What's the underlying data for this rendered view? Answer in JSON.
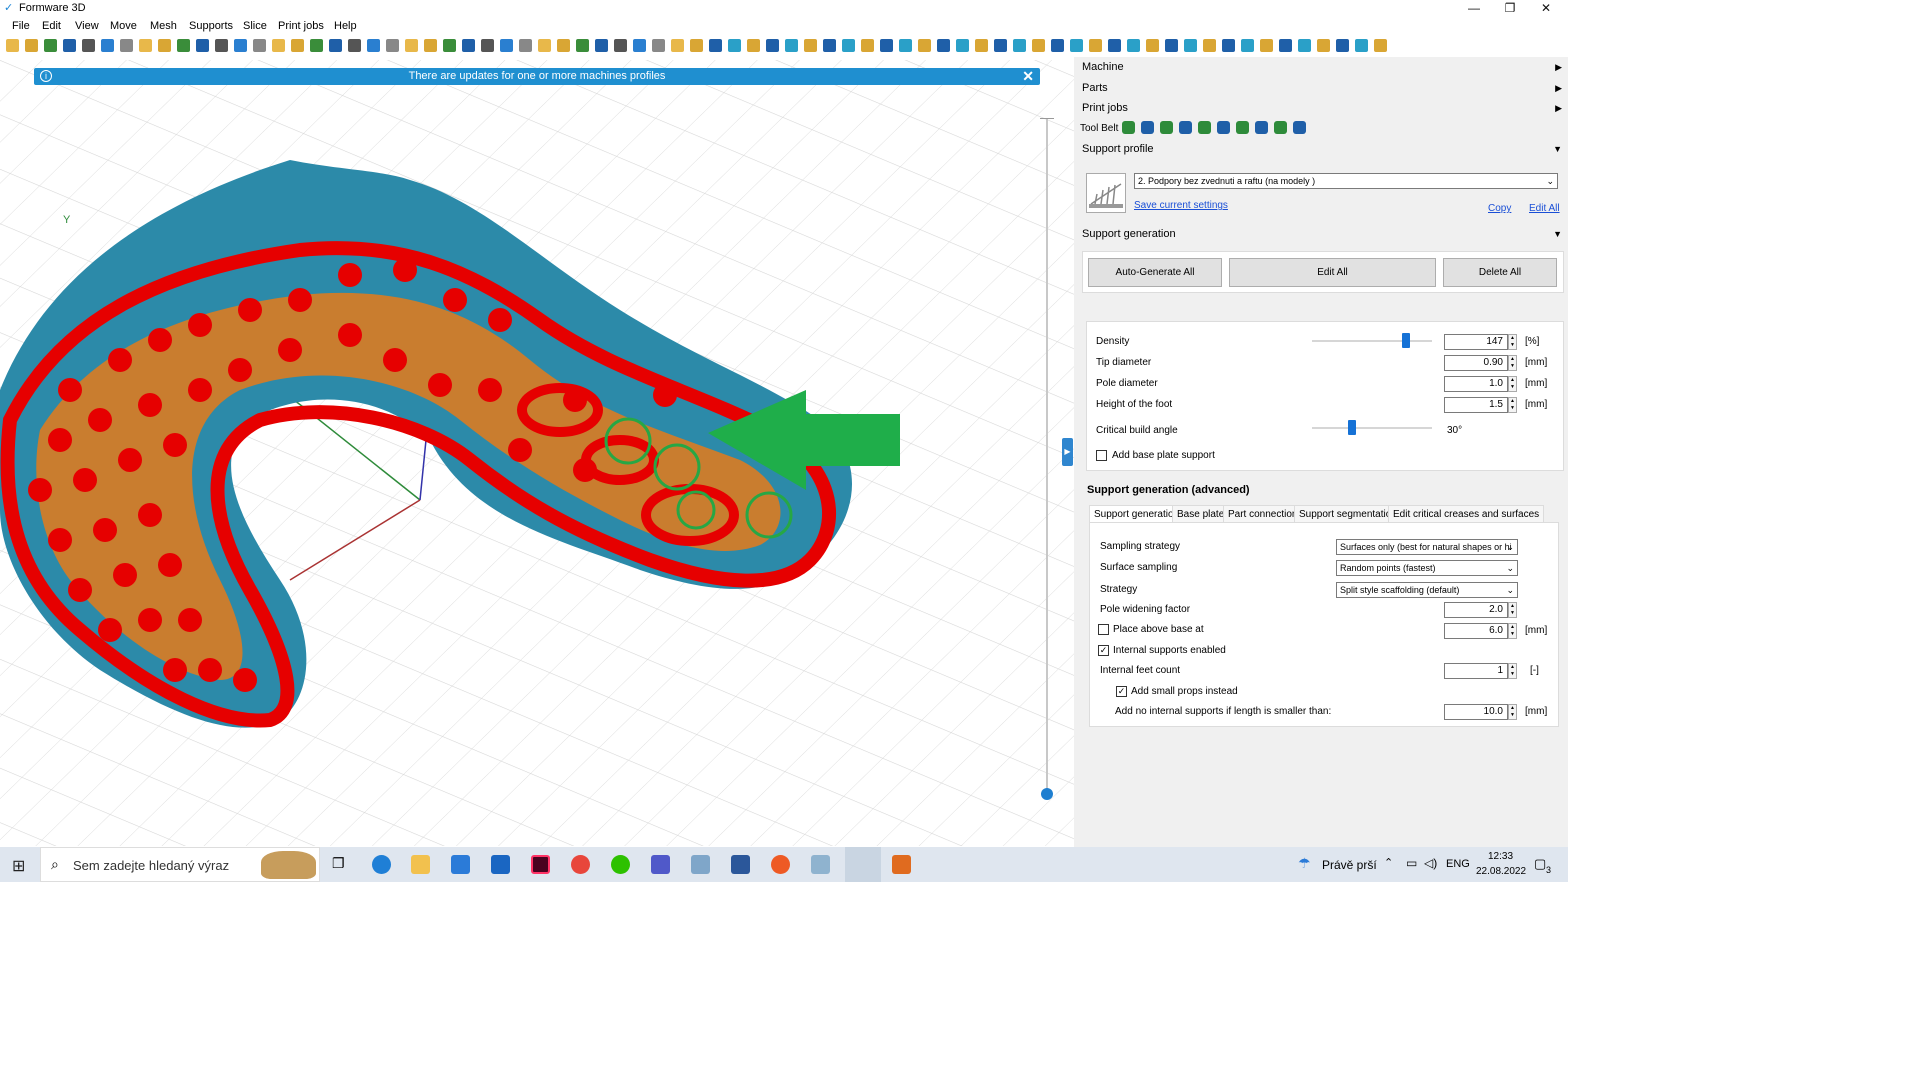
{
  "window": {
    "title": "Formware 3D",
    "min_icon": "minimize-icon",
    "max_icon": "maximize-icon",
    "close_icon": "close-icon"
  },
  "menu": [
    "File",
    "Edit",
    "View",
    "Move",
    "Mesh",
    "Supports",
    "Slice",
    "Print jobs",
    "Help"
  ],
  "toolbar": {
    "icons": [
      "new-file-icon",
      "open-folder-icon",
      "open-folder-icon",
      "import-icon",
      "export-icon",
      "save-icon",
      "export-icon",
      "printer-icon",
      "gear-icon",
      "export-icon",
      "save-icon",
      "trash-icon",
      "undo-icon",
      "redo-icon",
      "link-icon",
      "info-icon",
      "zoom-icon",
      "pen-icon",
      "view-cube-icon",
      "view-cube-icon",
      "view-cube-icon",
      "view-cube-icon",
      "view-cube-icon",
      "view-cube-icon",
      "view-cube-icon",
      "sphere-icon",
      "wireframe-icon",
      "sphere-icon",
      "circle-icon",
      "support-icon",
      "support-icon",
      "support-icon",
      "grid-icon",
      "bowl-icon",
      "bowl-icon",
      "red-sphere-icon",
      "support-icon"
    ]
  },
  "banner": {
    "text": "There are updates for one or more machines profiles",
    "info_icon": "info-icon",
    "close_icon": "close-icon"
  },
  "panel": {
    "machine": "Machine",
    "parts": "Parts",
    "print_jobs": "Print jobs",
    "tool_belt": "Tool Belt",
    "support_profile": "Support profile",
    "profile_selected": "2. Podpory bez zvednuti a raftu (na modely )",
    "save_settings": "Save current settings",
    "copy": "Copy",
    "edit_all_link": "Edit All",
    "support_generation": "Support generation",
    "btn_auto": "Auto-Generate All",
    "btn_edit": "Edit All",
    "btn_delete": "Delete All",
    "density_label": "Density",
    "density_value": "147",
    "density_unit": "[%]",
    "density_level": 0.78,
    "tip_label": "Tip diameter",
    "tip_value": "0.90",
    "tip_unit": "[mm]",
    "pole_label": "Pole diameter",
    "pole_value": "1.0",
    "pole_unit": "[mm]",
    "foot_label": "Height of the foot",
    "foot_value": "1.5",
    "foot_unit": "[mm]",
    "critical_label": "Critical build angle",
    "critical_value": "30°",
    "critical_level": 0.33,
    "base_plate_support": "Add base plate support",
    "advanced_title": "Support generation (advanced)",
    "tabs": [
      "Support generation",
      "Base plate",
      "Part connection",
      "Support segmentation",
      "Edit critical creases and surfaces"
    ],
    "sampling_label": "Sampling strategy",
    "sampling_value": "Surfaces only (best for natural shapes or hi",
    "surface_label": "Surface sampling",
    "surface_value": "Random points (fastest)",
    "strategy_label": "Strategy",
    "strategy_value": "Split style scaffolding (default)",
    "widen_label": "Pole widening factor",
    "widen_value": "2.0",
    "place_label": "Place above base at",
    "place_value": "6.0",
    "place_unit": "[mm]",
    "internal_label": "Internal supports enabled",
    "feet_label": "Internal feet count",
    "feet_value": "1",
    "feet_unit": "[-]",
    "props_label": "Add small props instead",
    "noint_label": "Add no internal supports if length is smaller than:",
    "noint_value": "10.0",
    "noint_unit": "[mm]"
  },
  "taskbar": {
    "search_placeholder": "Sem zadejte hledaný výraz",
    "weather": "Právě prší",
    "lang": "ENG",
    "time": "12:33",
    "date": "22.08.2022",
    "notif": "3"
  },
  "colors": {
    "accent": "#1f8fd0",
    "model": "#2f8fb0",
    "support_red": "#e60000",
    "support_orange": "#f2a020",
    "arrow_green": "#1fae4a"
  }
}
